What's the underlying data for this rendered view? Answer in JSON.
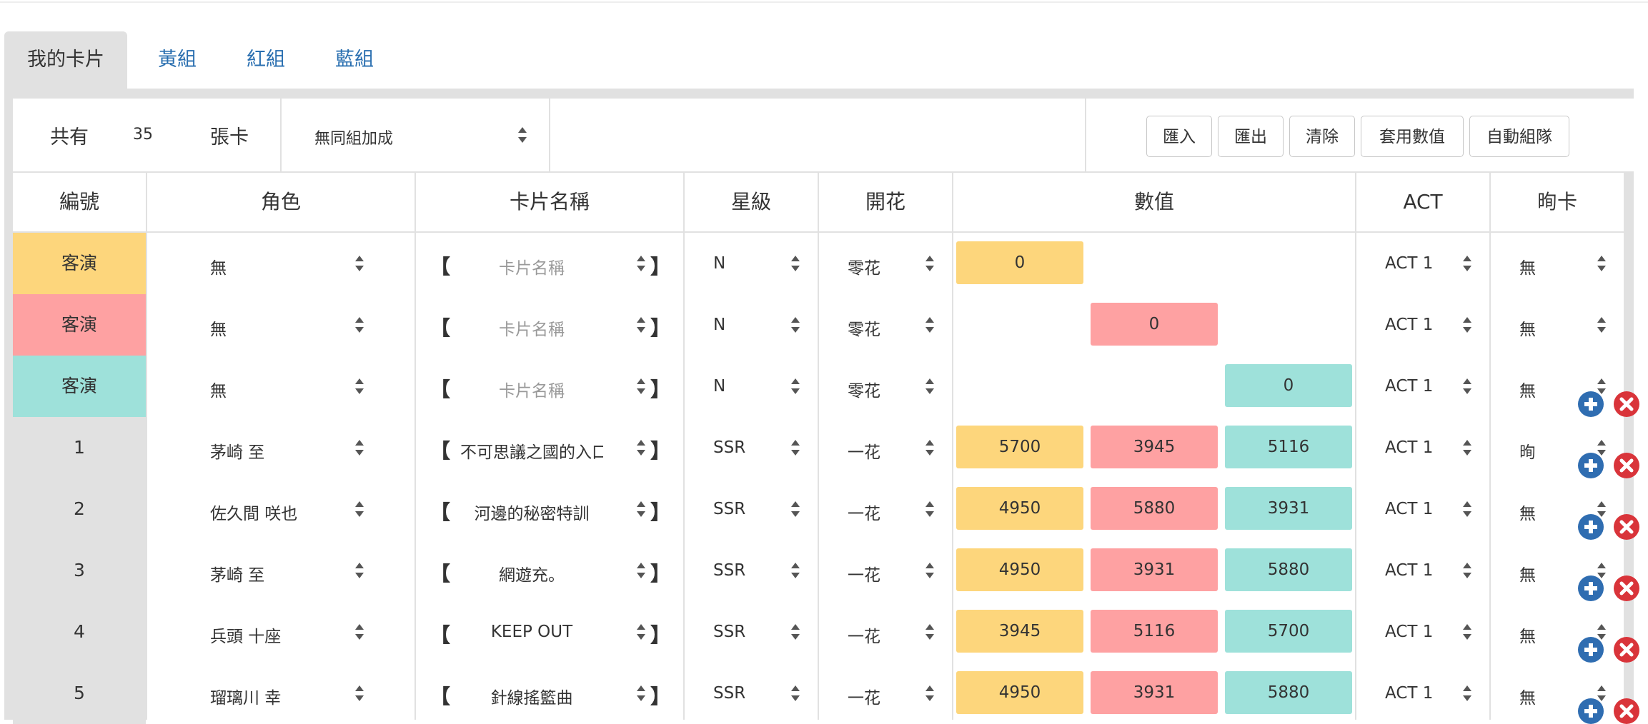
{
  "tabs": [
    {
      "label": "我的卡片",
      "active": true
    },
    {
      "label": "黃組",
      "active": false
    },
    {
      "label": "紅組",
      "active": false
    },
    {
      "label": "藍組",
      "active": false
    }
  ],
  "toolbar": {
    "total_prefix": "共有",
    "total_count": "35",
    "total_suffix": "張卡",
    "bonus_select": "無同組加成",
    "buttons": [
      "匯入",
      "匯出",
      "清除",
      "套用數值",
      "自動組隊"
    ]
  },
  "headers": [
    "編號",
    "角色",
    "卡片名稱",
    "星級",
    "開花",
    "數值",
    "ACT",
    "㫬卡"
  ],
  "card_brackets": {
    "open": "【",
    "close": "】"
  },
  "rows": [
    {
      "num": "客演",
      "num_color": "#fdd67c",
      "role": "無",
      "card": "卡片名稱",
      "placeholder": true,
      "star": "N",
      "bloom": "零花",
      "values": [
        "0",
        "",
        ""
      ],
      "act": "ACT 1",
      "shun": "無"
    },
    {
      "num": "客演",
      "num_color": "#fea1a2",
      "role": "無",
      "card": "卡片名稱",
      "placeholder": true,
      "star": "N",
      "bloom": "零花",
      "values": [
        "",
        "0",
        ""
      ],
      "act": "ACT 1",
      "shun": "無"
    },
    {
      "num": "客演",
      "num_color": "#9ee1da",
      "role": "無",
      "card": "卡片名稱",
      "placeholder": true,
      "star": "N",
      "bloom": "零花",
      "values": [
        "",
        "",
        "0"
      ],
      "act": "ACT 1",
      "shun": "無"
    },
    {
      "num": "1",
      "num_color": "#e1e1e1",
      "role": "茅崎 至",
      "card": "不可思議之國的入口",
      "placeholder": false,
      "star": "SSR",
      "bloom": "一花",
      "values": [
        "5700",
        "3945",
        "5116"
      ],
      "act": "ACT 1",
      "shun": "㫬"
    },
    {
      "num": "2",
      "num_color": "#e1e1e1",
      "role": "佐久間 咲也",
      "card": "河邊的秘密特訓",
      "placeholder": false,
      "star": "SSR",
      "bloom": "一花",
      "values": [
        "4950",
        "5880",
        "3931"
      ],
      "act": "ACT 1",
      "shun": "無"
    },
    {
      "num": "3",
      "num_color": "#e1e1e1",
      "role": "茅崎 至",
      "card": "網遊充。",
      "placeholder": false,
      "star": "SSR",
      "bloom": "一花",
      "values": [
        "4950",
        "3931",
        "5880"
      ],
      "act": "ACT 1",
      "shun": "無"
    },
    {
      "num": "4",
      "num_color": "#e1e1e1",
      "role": "兵頭 十座",
      "card": "KEEP OUT",
      "placeholder": false,
      "star": "SSR",
      "bloom": "一花",
      "values": [
        "3945",
        "5116",
        "5700"
      ],
      "act": "ACT 1",
      "shun": "無"
    },
    {
      "num": "5",
      "num_color": "#e1e1e1",
      "role": "瑠璃川 幸",
      "card": "針線搖籃曲",
      "placeholder": false,
      "star": "SSR",
      "bloom": "一花",
      "values": [
        "4950",
        "3931",
        "5880"
      ],
      "act": "ACT 1",
      "shun": "無"
    }
  ],
  "colors": {
    "yellow": "#fdd67c",
    "red": "#fea1a2",
    "teal": "#9ee1da",
    "add": "#2f6db1",
    "delete": "#d9343a",
    "link": "#2a6fb0"
  },
  "icons": {
    "add": "plus-circle-icon",
    "delete": "close-circle-icon",
    "select": "updown-arrows-icon"
  }
}
